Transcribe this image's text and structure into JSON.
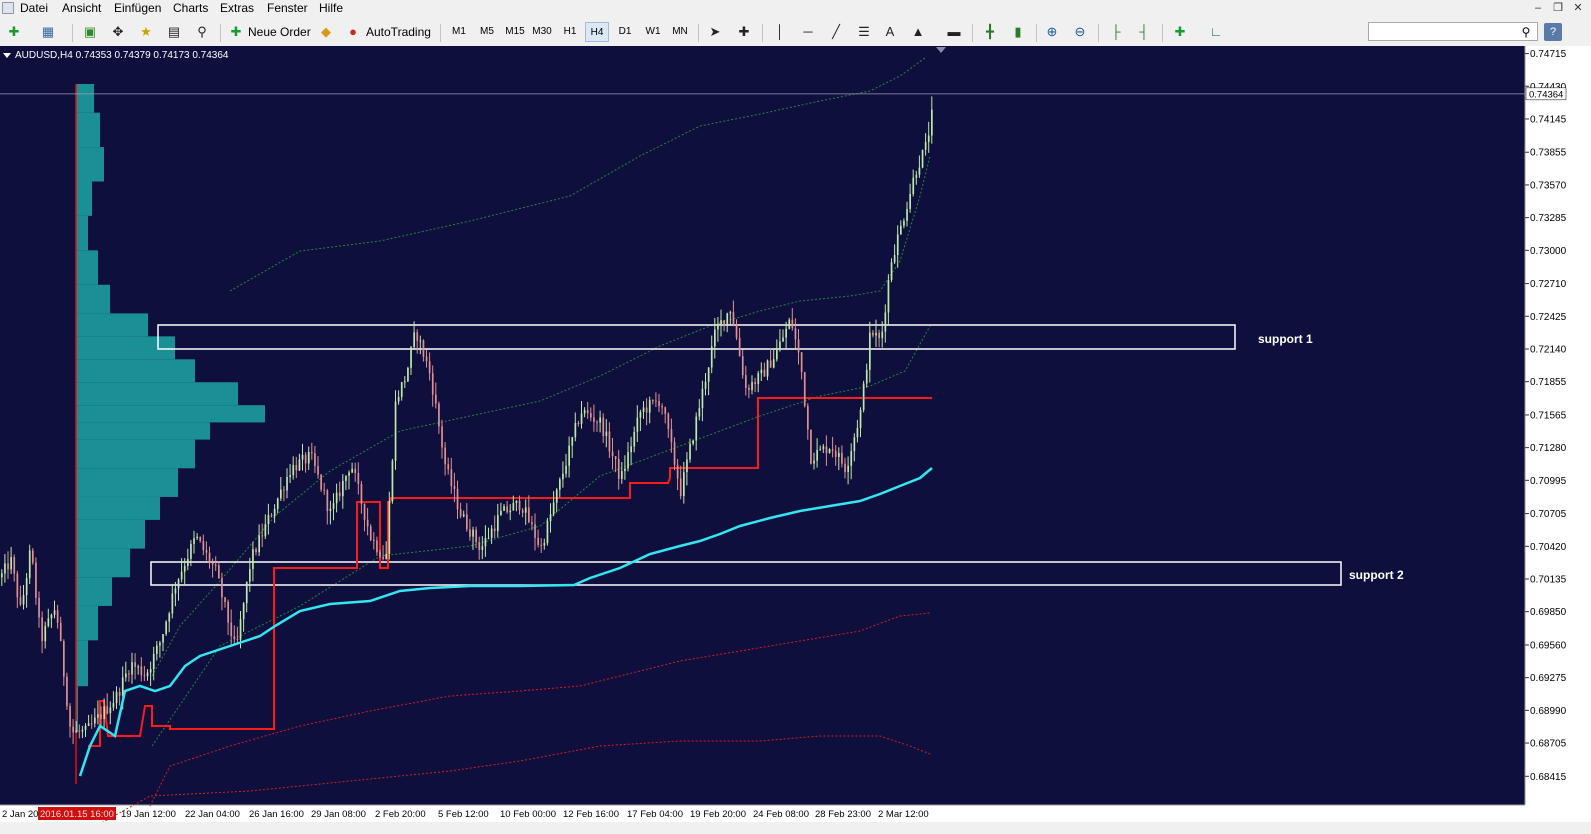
{
  "menu": [
    "Datei",
    "Ansicht",
    "Einfügen",
    "Charts",
    "Extras",
    "Fenster",
    "Hilfe"
  ],
  "toolbar": {
    "new_order": "Neue Order",
    "autotrading": "AutoTrading",
    "timeframes": [
      "M1",
      "M5",
      "M15",
      "M30",
      "H1",
      "H4",
      "D1",
      "W1",
      "MN"
    ],
    "active_timeframe": "H4"
  },
  "chart": {
    "info": "AUDUSD,H4  0.74353 0.74379 0.74173 0.74364",
    "current_price": "0.74364",
    "price_levels": [
      "0.74715",
      "0.74430",
      "0.74145",
      "0.73855",
      "0.73570",
      "0.73285",
      "0.73000",
      "0.72710",
      "0.72425",
      "0.72140",
      "0.71855",
      "0.71565",
      "0.71280",
      "0.70995",
      "0.70705",
      "0.70420",
      "0.70135",
      "0.69850",
      "0.69560",
      "0.69275",
      "0.68990",
      "0.68705",
      "0.68415",
      "0.68130"
    ],
    "time_labels": [
      "2 Jan 20",
      "2016.01.15 16:00",
      "19 Jan 12:00",
      "22 Jan 04:00",
      "26 Jan 16:00",
      "29 Jan 08:00",
      "2 Feb 20:00",
      "5 Feb 12:00",
      "10 Feb 00:00",
      "12 Feb 16:00",
      "17 Feb 04:00",
      "19 Feb 20:00",
      "24 Feb 08:00",
      "28 Feb 23:00",
      "2 Mar 12:00"
    ],
    "zones": [
      "support 1",
      "support 2"
    ]
  },
  "colors": {
    "background": "#0f0f3d",
    "bull": "#c0e8a8",
    "bear": "#e09090",
    "profile": "#1a8f94",
    "red_line": "#ff1a1a",
    "vwap": "#33e6f2",
    "green_band": "#1f8a3c",
    "red_band": "#d02020"
  },
  "chart_data": {
    "type": "candlestick",
    "symbol": "AUDUSD",
    "timeframe": "H4",
    "last": {
      "open": 0.74353,
      "high": 0.74379,
      "low": 0.74173,
      "close": 0.74364
    },
    "ylim": [
      0.6813,
      0.7472
    ],
    "support_zones": [
      {
        "label": "support 1",
        "range": [
          0.7213,
          0.7234
        ]
      },
      {
        "label": "support 2",
        "range": [
          0.7008,
          0.7027
        ]
      }
    ]
  }
}
